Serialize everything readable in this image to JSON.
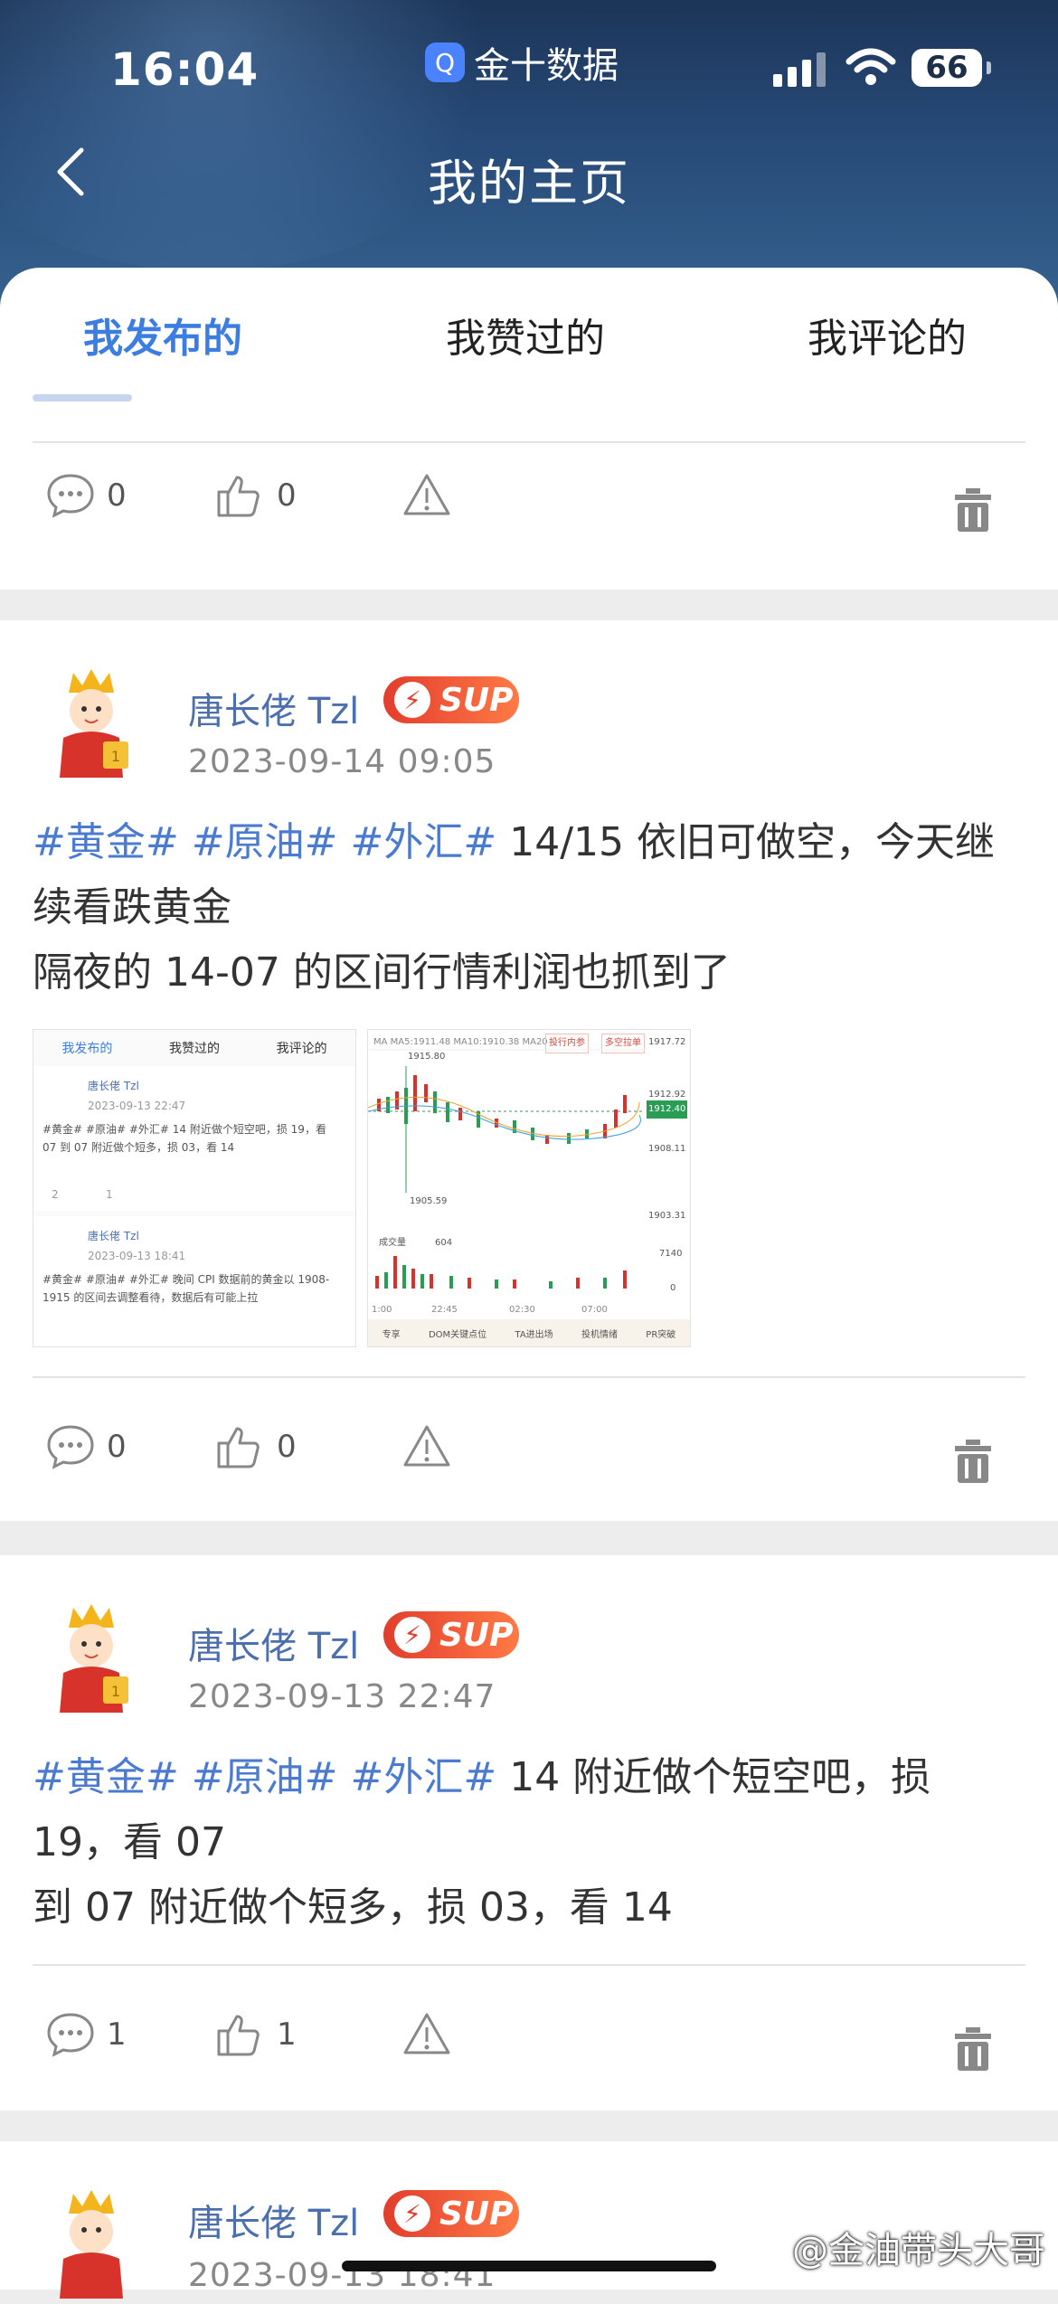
{
  "status": {
    "time": "16:04",
    "carrier": "金十数据",
    "battery": "66"
  },
  "nav": {
    "title": "我的主页"
  },
  "tabs": [
    {
      "label": "我发布的",
      "active": true
    },
    {
      "label": "我赞过的",
      "active": false
    },
    {
      "label": "我评论的",
      "active": false
    }
  ],
  "posts": [
    {
      "comments": "0",
      "likes": "0"
    },
    {
      "author": "唐长佬 Tzl",
      "badge": "SUP",
      "datetime": "2023-09-14 09:05",
      "tags": [
        "#黄金#",
        "#原油#",
        "#外汇#"
      ],
      "line1": "14/15 依旧可做空，今天继",
      "line2": "续看跌黄金",
      "line3": "隔夜的 14-07 的区间行情利润也抓到了",
      "comments": "0",
      "likes": "0",
      "thumb_left": {
        "tabs": [
          "我发布的",
          "我赞过的",
          "我评论的"
        ],
        "items": [
          {
            "author": "唐长佬 Tzl",
            "date": "2023-09-13 22:47",
            "text": "#黄金# #原油# #外汇# 14 附近做个短空吧，损 19，看 07 到 07 附近做个短多，损 03，看 14",
            "comments": "2",
            "likes": "1"
          },
          {
            "author": "唐长佬 Tzl",
            "date": "2023-09-13 18:41",
            "text": "#黄金# #原油# #外汇# 晚间 CPI 数据前的黄金以 1908-1915 的区间去调整看待，数据后有可能上拉"
          }
        ]
      },
      "thumb_right": {
        "ma_legend": "MA  MA5:1911.48  MA10:1910.38  MA20",
        "btn1": "投行内参",
        "btn2": "多空拉单",
        "prices": [
          "1917.72",
          "1912.92",
          "1912.40",
          "1908.11",
          "1903.31",
          "7140",
          "0"
        ],
        "high": "1915.80",
        "low": "1905.59",
        "vol_label": "成交量",
        "vol_value": "604",
        "times": [
          "1:00",
          "22:45",
          "02:30",
          "07:00"
        ],
        "footer": [
          "专享",
          "DOM关键点位",
          "TA进出场",
          "投机情绪",
          "PR突破"
        ]
      }
    },
    {
      "author": "唐长佬 Tzl",
      "badge": "SUP",
      "datetime": "2023-09-13 22:47",
      "tags": [
        "#黄金#",
        "#原油#",
        "#外汇#"
      ],
      "line1": "14 附近做个短空吧，损",
      "line2": "19，看 07",
      "line3": "到 07 附近做个短多，损 03，看 14",
      "comments": "1",
      "likes": "1"
    },
    {
      "author": "唐长佬 Tzl",
      "badge": "SUP",
      "datetime": "2023-09-13 18:41"
    }
  ],
  "watermark": "@金油带头大哥",
  "colors": {
    "accent": "#3b7de0",
    "tag": "#4a7bd1",
    "header_top": "#1c3558",
    "badge": "#e23d2d"
  }
}
